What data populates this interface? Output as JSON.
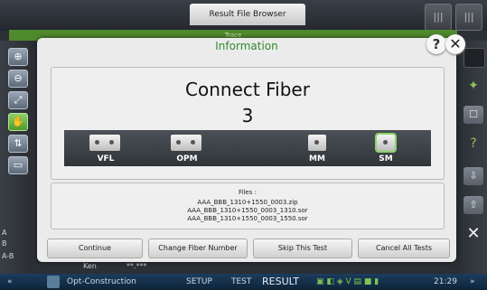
{
  "top": {
    "tab_label": "Result File Browser",
    "btn1_icon": "|||",
    "btn2_icon": "|||"
  },
  "trace": {
    "label": "Trace"
  },
  "left_tools": {
    "zoom_in": "⊕",
    "zoom_out": "⊖",
    "fit": "⤢",
    "hand": "✋",
    "markers": "⇅",
    "print": "▭",
    "label_a": "A",
    "label_b": "B",
    "label_ab": "A-B"
  },
  "right_tools": {
    "r1": "",
    "r2": "✦",
    "r3": "☐",
    "r4": "?",
    "r5": "⇩",
    "r6": "⇧",
    "r7": "✕"
  },
  "dialog": {
    "title": "Information",
    "help": "?",
    "close": "✕",
    "heading": "Connect Fiber",
    "count": "3",
    "ports": [
      {
        "label": "VFL",
        "selected": false
      },
      {
        "label": "OPM",
        "selected": false
      },
      {
        "label": "MM",
        "selected": false
      },
      {
        "label": "SM",
        "selected": true
      }
    ],
    "files_heading": "Files :",
    "files": [
      "AAA_BBB_1310+1550_0003.zip",
      "AAA_BBB_1310+1550_0003_1310.sor",
      "AAA_BBB_1310+1550_0003_1550.sor"
    ],
    "buttons": {
      "continue": "Continue",
      "change_fiber": "Change Fiber Number",
      "skip": "Skip This Test",
      "cancel_all": "Cancel All Tests"
    }
  },
  "bg_row": {
    "col1": "Ken",
    "col2": "**.***"
  },
  "bottom": {
    "left_arrows": "«",
    "app_name": "Opt-Construction",
    "setup": "SETUP",
    "test": "TEST",
    "result": "RESULT",
    "status_icons": "▣ ◧ ◈ V ▤ ■ ▮",
    "time": "21:29",
    "right_arrows": "»"
  }
}
